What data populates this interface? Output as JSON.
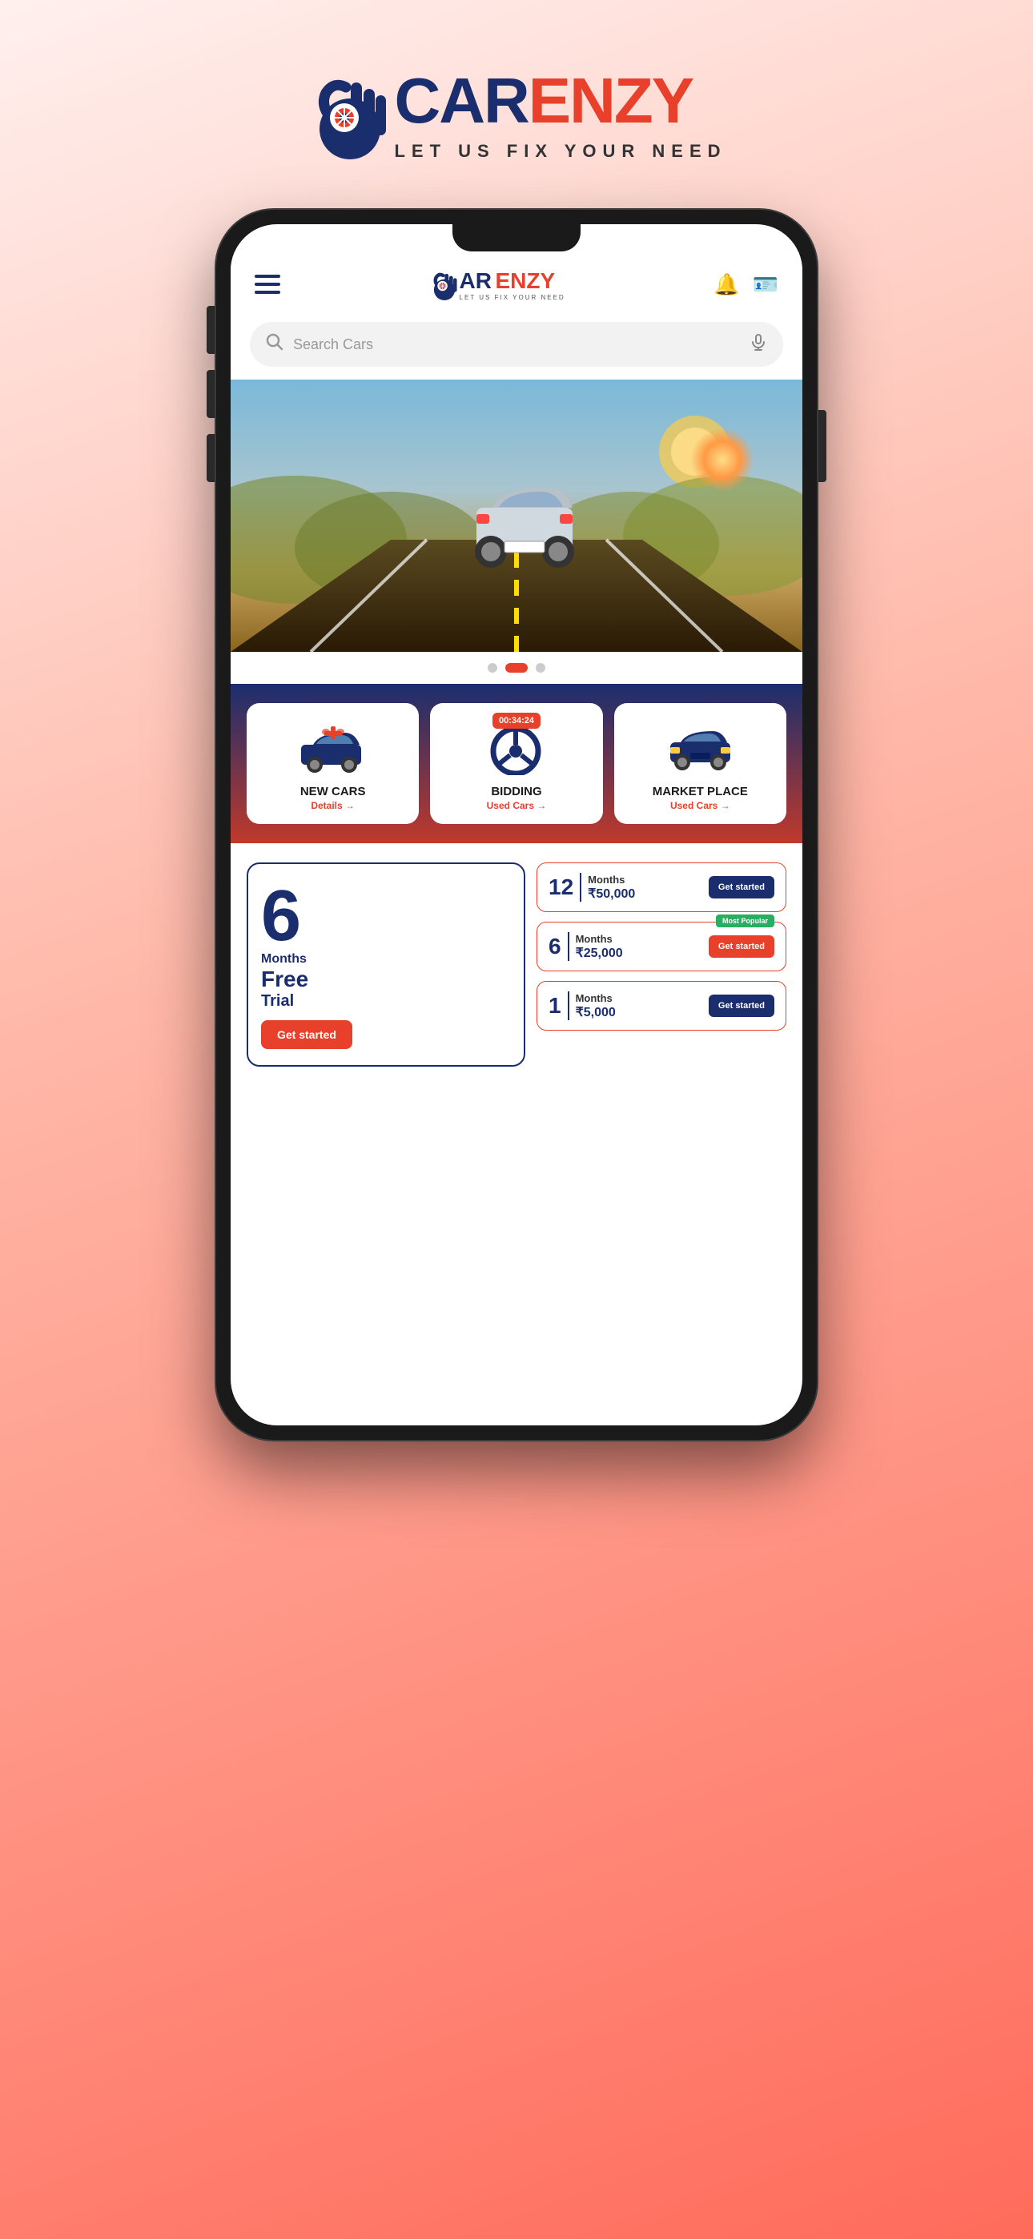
{
  "app": {
    "name": "CarEnzy",
    "tagline": "LET US FIX YOUR NEED",
    "logo": {
      "text_car": "AR",
      "text_enzy": "ENZY",
      "prefix": "C"
    }
  },
  "header": {
    "search_placeholder": "Search Cars",
    "notification_icon": "bell",
    "wallet_icon": "wallet"
  },
  "hero": {
    "dots": [
      {
        "active": false
      },
      {
        "active": true
      },
      {
        "active": false
      }
    ]
  },
  "categories": [
    {
      "id": "new_cars",
      "title": "NEW CARS",
      "subtitle": "Details",
      "link": "Details →",
      "icon": "gift-car"
    },
    {
      "id": "bidding",
      "title": "BIDDING",
      "subtitle": "Used Cars",
      "link": "Used Cars →",
      "timer": "00:34:24",
      "icon": "steering"
    },
    {
      "id": "marketplace",
      "title": "MARKET PLACE",
      "subtitle": "Used Cars",
      "link": "Used Cars →",
      "icon": "car-front"
    }
  ],
  "pricing": {
    "free_trial": {
      "number": "6",
      "months_label": "Months",
      "free_label": "Free",
      "trial_label": "Trial",
      "btn_label": "Get started"
    },
    "plans": [
      {
        "number": "12",
        "months": "Months",
        "price": "₹50,000",
        "btn": "Get started",
        "popular": false
      },
      {
        "number": "6",
        "months": "Months",
        "price": "₹25,000",
        "btn": "Get started",
        "popular": true,
        "popular_label": "Most Popular"
      },
      {
        "number": "1",
        "months": "Months",
        "price": "₹5,000",
        "btn": "Get started",
        "popular": false
      }
    ]
  }
}
